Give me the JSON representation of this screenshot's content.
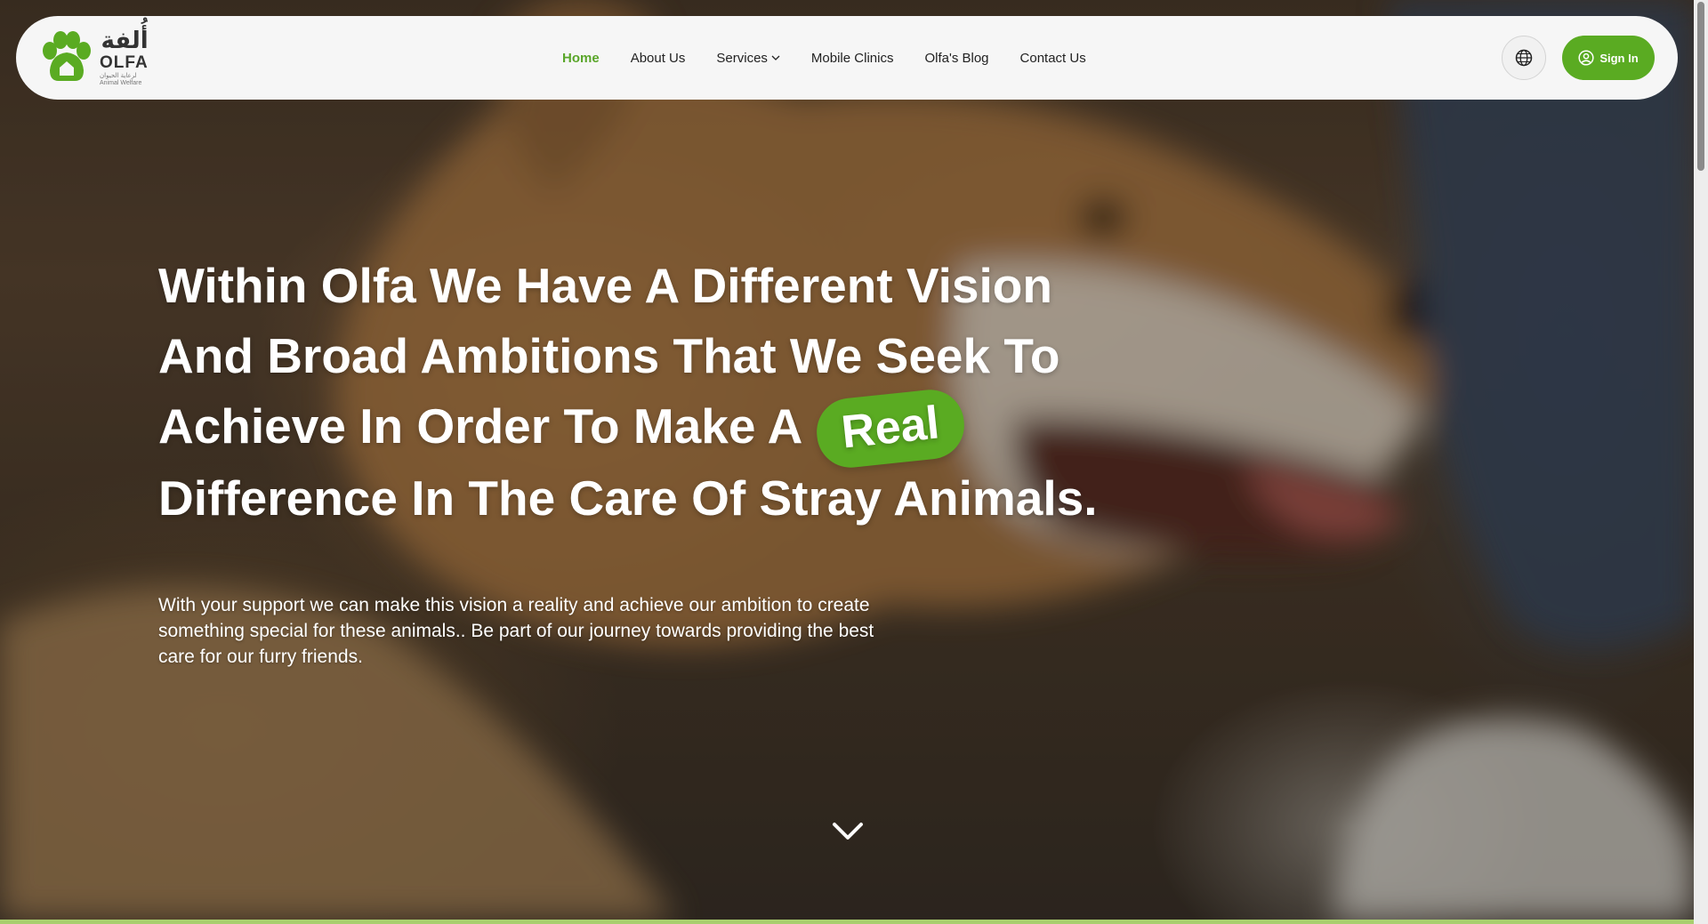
{
  "brand": {
    "name_ar": "أُلفة",
    "name_en": "OLFA",
    "tagline_ar": "لرعاية الحيوان",
    "tagline_en": "Animal Welfare",
    "color": "#5aab22"
  },
  "nav": {
    "items": [
      {
        "label": "Home",
        "active": true
      },
      {
        "label": "About Us"
      },
      {
        "label": "Services",
        "has_dropdown": true
      },
      {
        "label": "Mobile Clinics"
      },
      {
        "label": "Olfa's Blog"
      },
      {
        "label": "Contact Us"
      }
    ],
    "language_icon": "globe-icon",
    "signin_icon": "user-circle-icon",
    "signin_label": "Sign In",
    "active_color": "#5aa62a"
  },
  "hero": {
    "headline_line1": "Within Olfa We Have A Different Vision",
    "headline_line2": "And Broad Ambitions That We Seek To",
    "headline_line3": "Achieve In Order To Make A",
    "headline_badge": "Real",
    "headline_line4": "Difference In The Care Of Stray Animals.",
    "subtext": "With your support we can make this vision a reality and achieve our ambition to create something special for these animals.. Be part of our journey towards providing the best care for our furry friends.",
    "scroll_icon": "chevron-down-icon"
  }
}
